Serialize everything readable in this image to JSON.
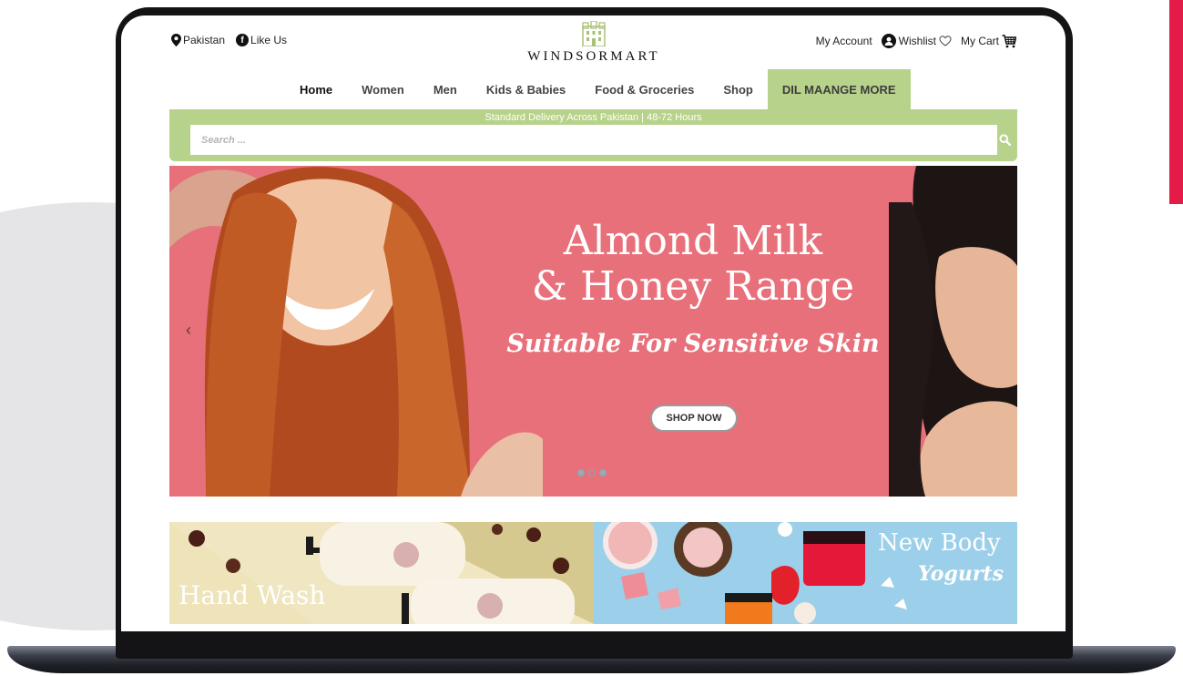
{
  "topbar": {
    "location_label": "Pakistan",
    "social_label": "Like Us",
    "social_icon_glyph": "f",
    "account_label": "My Account",
    "wishlist_label": "Wishlist",
    "cart_label": "My Cart"
  },
  "logo": {
    "text": "WINDSORMART"
  },
  "nav": {
    "items": [
      {
        "label": "Home"
      },
      {
        "label": "Women"
      },
      {
        "label": "Men"
      },
      {
        "label": "Kids & Babies"
      },
      {
        "label": "Food & Groceries"
      },
      {
        "label": "Shop"
      },
      {
        "label": "DIL MAANGE MORE"
      }
    ]
  },
  "search": {
    "banner_text": "Standard Delivery Across Pakistan | 48-72 Hours",
    "placeholder": "Search ..."
  },
  "hero": {
    "prev_glyph": "‹",
    "title_line1": "Almond Milk",
    "title_line2": "& Honey Range",
    "subtitle": "Suitable For Sensitive Skin",
    "cta_label": "SHOP NOW",
    "slide_count": 3,
    "active_slide": 1
  },
  "promos": {
    "left_label": "Hand Wash",
    "right_title": "New Body",
    "right_subtitle": "Yogurts"
  },
  "colors": {
    "accent_green": "#b7d28b",
    "hero_pink": "#e8707a",
    "brand_red": "#e31b46",
    "promo_yellow": "#eee3b9",
    "promo_blue": "#9ccfe9"
  }
}
